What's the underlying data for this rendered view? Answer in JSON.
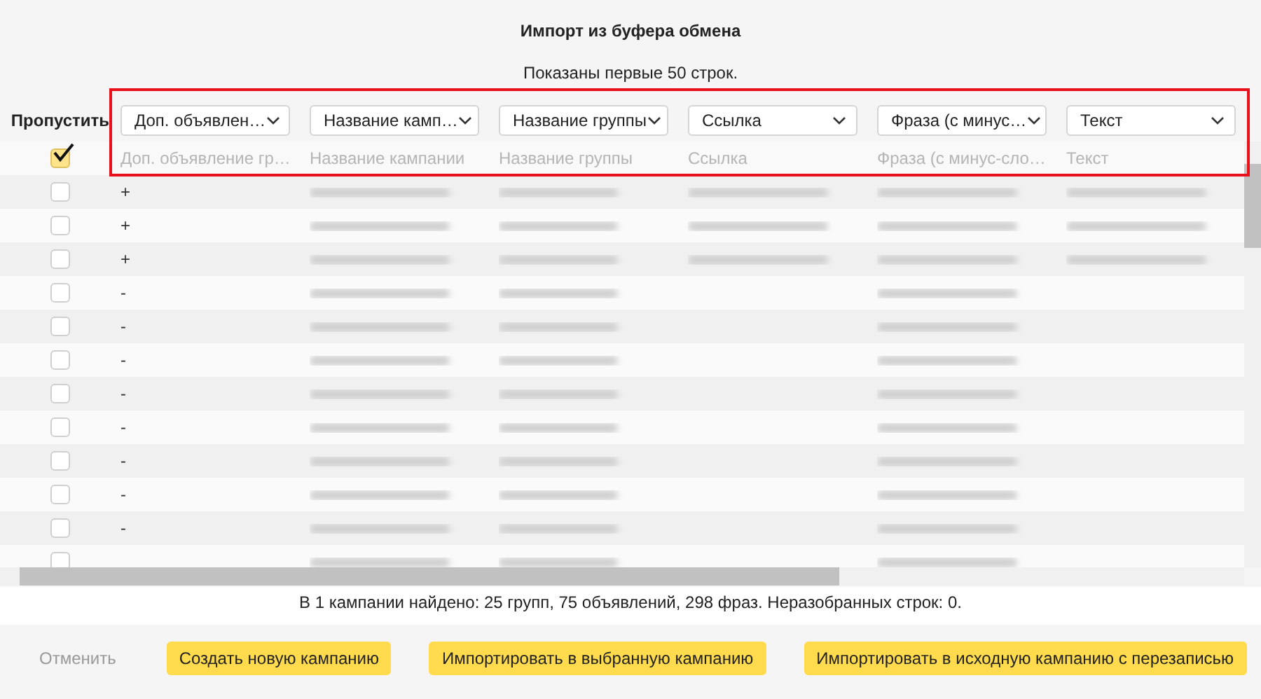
{
  "dialog": {
    "title": "Импорт из буфера обмена",
    "subtitle": "Показаны первые 50 строк."
  },
  "table": {
    "skip_label": "Пропустить",
    "skip_all_checked": true,
    "columns": [
      {
        "select": "Доп. объявлен…",
        "placeholder": "Доп. объявление гр…"
      },
      {
        "select": "Название камп…",
        "placeholder": "Название кампании"
      },
      {
        "select": "Название группы",
        "placeholder": "Название группы"
      },
      {
        "select": "Ссылка",
        "placeholder": "Ссылка"
      },
      {
        "select": "Фраза (с минус…",
        "placeholder": "Фраза (с минус-сло…"
      },
      {
        "select": "Текст",
        "placeholder": "Текст"
      }
    ],
    "rows": [
      {
        "checked": false,
        "extra": "+",
        "blurred": [
          true,
          true,
          true,
          true,
          true
        ]
      },
      {
        "checked": false,
        "extra": "+",
        "blurred": [
          true,
          true,
          true,
          true,
          true
        ]
      },
      {
        "checked": false,
        "extra": "+",
        "blurred": [
          true,
          true,
          true,
          true,
          true
        ]
      },
      {
        "checked": false,
        "extra": "-",
        "blurred": [
          true,
          true,
          false,
          true,
          false
        ]
      },
      {
        "checked": false,
        "extra": "-",
        "blurred": [
          true,
          true,
          false,
          true,
          false
        ]
      },
      {
        "checked": false,
        "extra": "-",
        "blurred": [
          true,
          true,
          false,
          true,
          false
        ]
      },
      {
        "checked": false,
        "extra": "-",
        "blurred": [
          true,
          true,
          false,
          true,
          false
        ]
      },
      {
        "checked": false,
        "extra": "-",
        "blurred": [
          true,
          true,
          false,
          true,
          false
        ]
      },
      {
        "checked": false,
        "extra": "-",
        "blurred": [
          true,
          true,
          false,
          true,
          false
        ]
      },
      {
        "checked": false,
        "extra": "-",
        "blurred": [
          true,
          true,
          false,
          true,
          false
        ]
      },
      {
        "checked": false,
        "extra": "-",
        "blurred": [
          true,
          true,
          false,
          true,
          false
        ]
      },
      {
        "checked": false,
        "blurred": [
          true,
          true,
          false,
          true,
          false
        ]
      }
    ]
  },
  "summary": "В 1 кампании найдено: 25 групп, 75 объявлений, 298 фраз. Неразобранных строк: 0.",
  "buttons": [
    {
      "label": "Отменить",
      "kind": "link"
    },
    {
      "label": "Создать новую кампанию",
      "kind": "primary"
    },
    {
      "label": "Импортировать в выбранную кампанию",
      "kind": "primary"
    },
    {
      "label": "Импортировать в исходную кампанию с перезаписью",
      "kind": "primary"
    }
  ]
}
